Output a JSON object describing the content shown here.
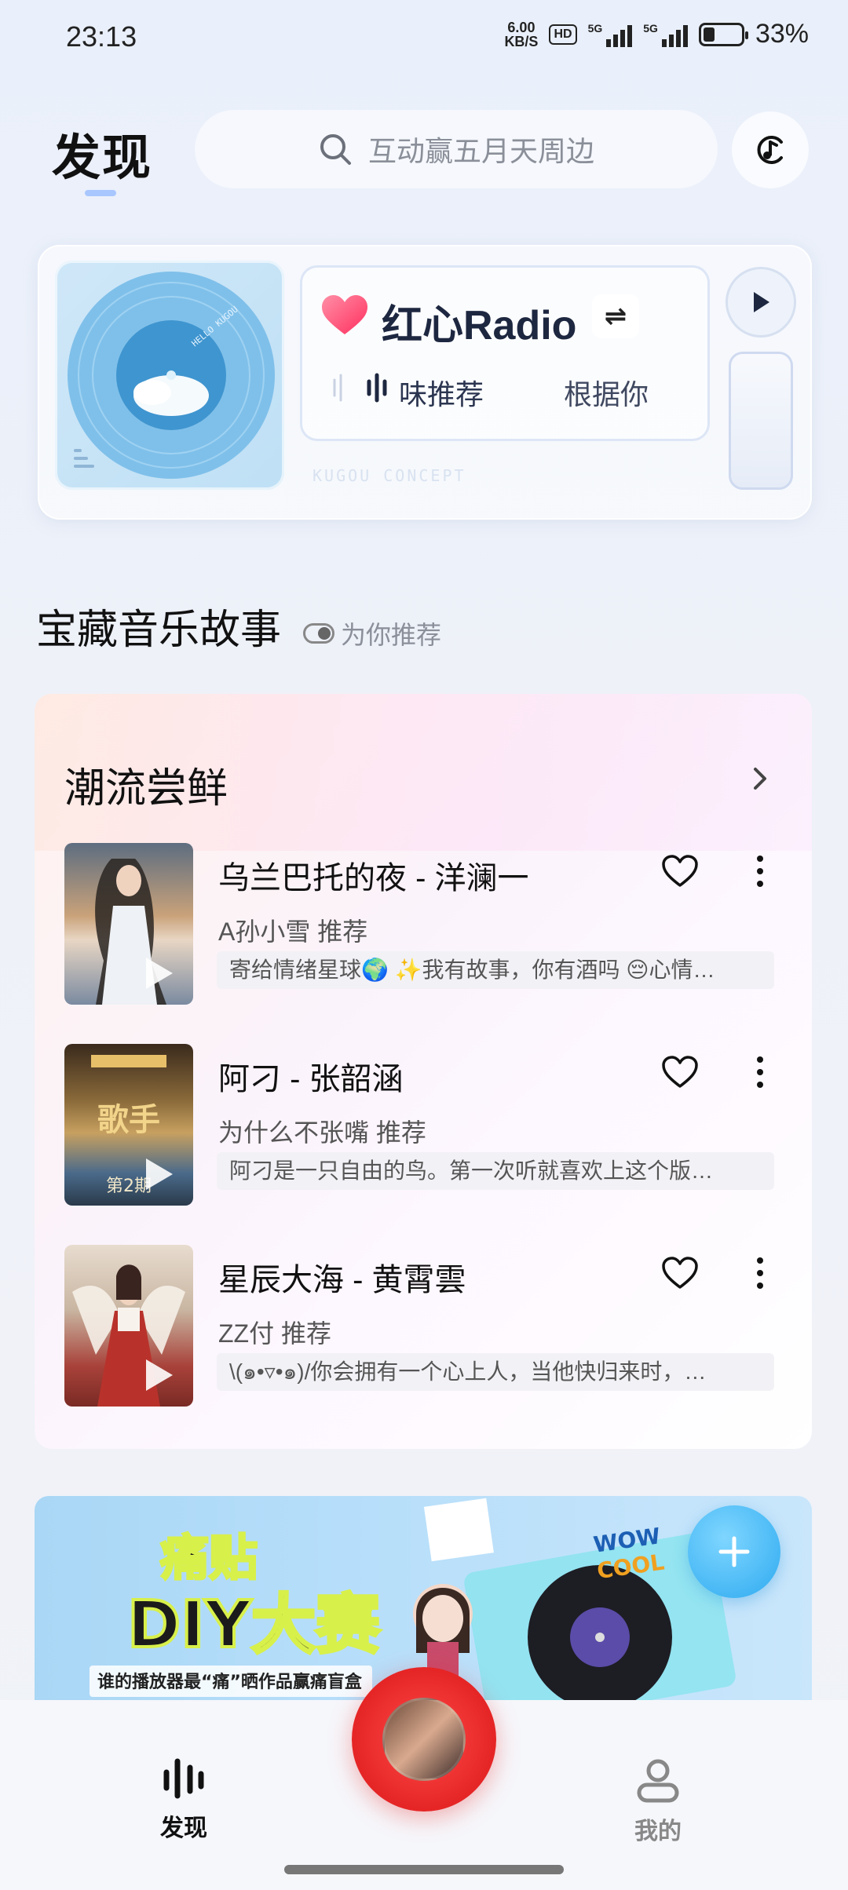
{
  "status_bar": {
    "time": "23:13",
    "net_speed_value": "6.00",
    "net_speed_unit": "KB/S",
    "hd_label": "HD",
    "signal1_label": "5G",
    "signal2_label": "5G",
    "battery_percent": 33,
    "battery_label": "33%"
  },
  "header": {
    "title": "发现",
    "search_placeholder": "互动赢五月天周边"
  },
  "radio": {
    "title": "红心Radio",
    "switch_icon": "⇌",
    "subtitle_1": "味推荐",
    "subtitle_2": "根据你",
    "concept_label": "KUGOU CONCEPT",
    "disc_text": "HELLO KUGOU"
  },
  "section": {
    "title": "宝藏音乐故事",
    "toggle_label": "为你推荐"
  },
  "trending": {
    "title": "潮流尝鲜",
    "songs": [
      {
        "name": "乌兰巴托的夜 - 洋澜一",
        "recommender": "A孙小雪 推荐",
        "description": "寄给情绪星球🌍 ✨我有故事，你有酒吗 😔心情…"
      },
      {
        "name": "阿刁 - 张韶涵",
        "recommender": "为什么不张嘴 推荐",
        "description": "阿刁是一只自由的鸟。第一次听就喜欢上这个版…"
      },
      {
        "name": "星辰大海 - 黄霄雲",
        "recommender": "ZZ付 推荐",
        "description": "\\(๑•▿•๑)/你会拥有一个心上人，当他快归来时，…"
      }
    ]
  },
  "banner": {
    "headline_1": "痛贴",
    "headline_2": "DIY大赛",
    "caption": "谁的播放器最“痛”晒作品赢痛盲盒",
    "sticker_1": "WOW",
    "sticker_2": "COOL"
  },
  "bottom_nav": {
    "discover_label": "发现",
    "mine_label": "我的"
  },
  "colors": {
    "accent_red": "#e52525",
    "fab_blue": "#2eaaf0",
    "heart_pink": "#ff4d73"
  }
}
